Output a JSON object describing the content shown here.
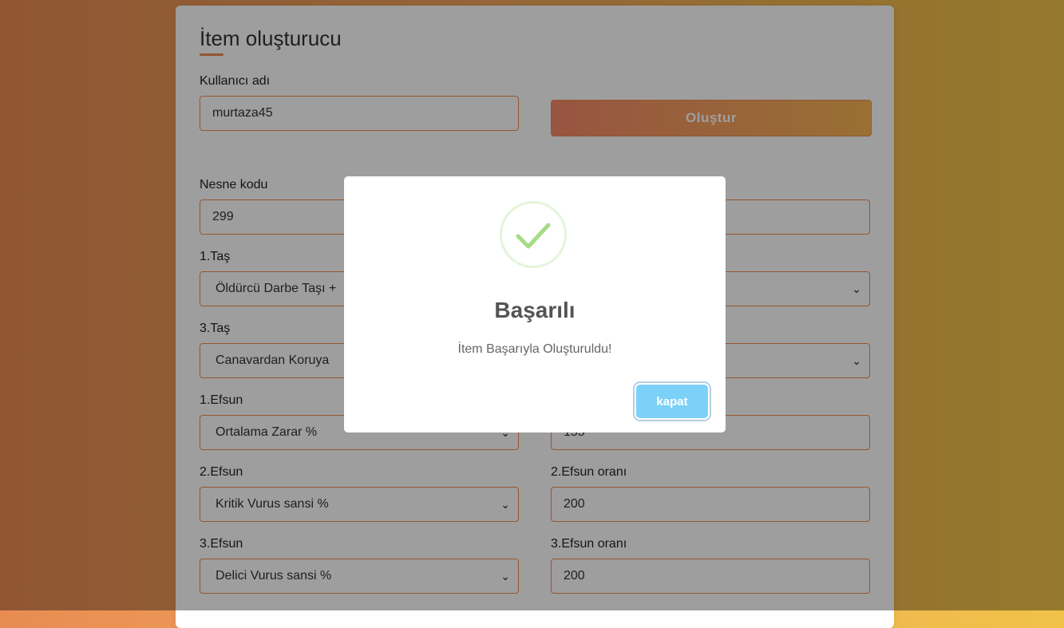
{
  "form": {
    "title": "İtem oluşturucu",
    "username_label": "Kullanıcı adı",
    "username_value": "murtaza45",
    "create_button": "Oluştur",
    "item_code_label": "Nesne kodu",
    "item_code_value": "299",
    "right_field_1_value": "",
    "stone1_label": "1.Taş",
    "stone1_value": "Öldürcü Darbe Taşı +",
    "stone2_value": "",
    "stone3_label": "3.Taş",
    "stone3_value": "Canavardan Koruya",
    "stone4_value": "",
    "bonus1_label": "1.Efsun",
    "bonus1_value": "Ortalama Zarar %",
    "bonus1_rate_value": "155",
    "bonus2_label": "2.Efsun",
    "bonus2_value": "Kritik Vurus sansi %",
    "bonus2_rate_label": "2.Efsun oranı",
    "bonus2_rate_value": "200",
    "bonus3_label": "3.Efsun",
    "bonus3_value": "Delici Vurus sansi %",
    "bonus3_rate_label": "3.Efsun oranı",
    "bonus3_rate_value": "200"
  },
  "modal": {
    "icon": "success-check-icon",
    "title": "Başarılı",
    "message": "İtem Başarıyla Oluşturuldu!",
    "close_label": "kapat"
  },
  "colors": {
    "accent": "#ef8b4f",
    "button_gradient_start": "#f5896a",
    "button_gradient_end": "#f7b554",
    "success_green": "#a5dc86",
    "confirm_blue": "#7cd1f9"
  }
}
